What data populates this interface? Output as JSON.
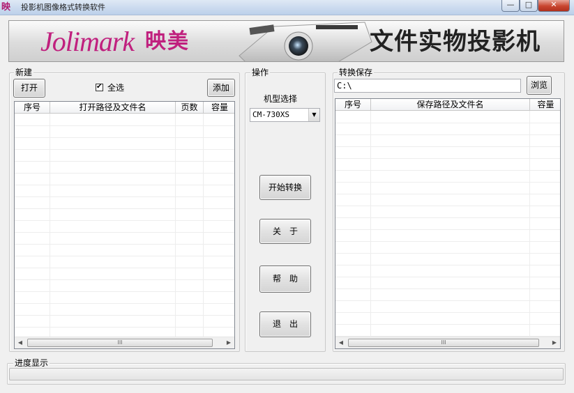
{
  "window": {
    "icon_text": "映",
    "title": "投影机图像格式转换软件",
    "min_label": "—",
    "max_label": "□",
    "close_label": "✕"
  },
  "banner": {
    "logo_text": "Jolimark",
    "logo_cn": "映美",
    "slogan": "文件实物投影机"
  },
  "new_group": {
    "legend": "新建",
    "open_label": "打开",
    "select_all_label": "全选",
    "select_all_checked": true,
    "add_label": "添加",
    "columns": [
      "序号",
      "打开路径及文件名",
      "页数",
      "容量"
    ],
    "scroll_thumb": "III"
  },
  "operation_group": {
    "legend": "操作",
    "model_label": "机型选择",
    "model_value": "CM-730XS",
    "start_label": "开始转换",
    "about_label": "关　于",
    "help_label": "帮　助",
    "exit_label": "退　出"
  },
  "save_group": {
    "legend": "转换保存",
    "path_value": "C:\\",
    "browse_label": "浏览",
    "columns": [
      "序号",
      "保存路径及文件名",
      "容量"
    ],
    "scroll_thumb": "III"
  },
  "progress_group": {
    "legend": "进度显示",
    "progress": 0
  },
  "icons": [
    "app-icon",
    "checkbox-check-icon",
    "dropdown-arrow-icon",
    "scroll-left-icon",
    "scroll-right-icon",
    "projector-image"
  ],
  "colors": {
    "brand": "#c0207e",
    "window_bg": "#f0f0f0"
  }
}
